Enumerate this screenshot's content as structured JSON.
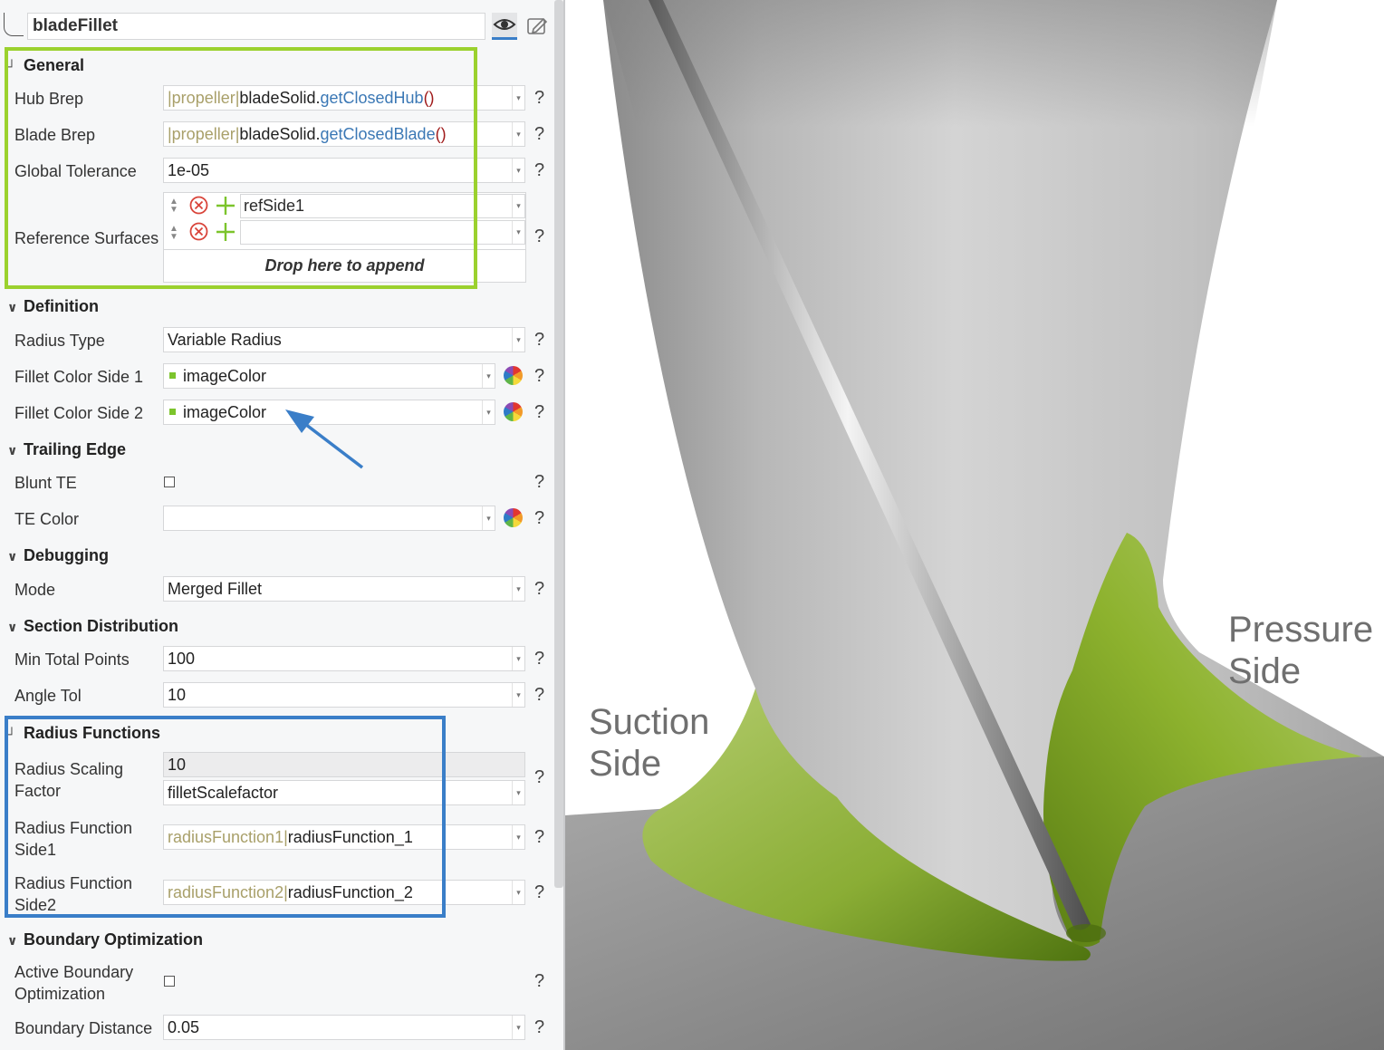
{
  "header": {
    "title": "bladeFillet",
    "eye_icon": "eye-icon",
    "edit_icon": "edit-icon"
  },
  "colors": {
    "green_box": "#9bd12e",
    "blue_box": "#3a7ec8",
    "arrow": "#3a7ec8",
    "fillet": "#8db22e"
  },
  "general": {
    "title": "General",
    "hub_brep": {
      "label": "Hub Brep",
      "ref": "|propeller|",
      "obj": "bladeSolid.",
      "fn": "getClosedHub",
      "paren": "()"
    },
    "blade_brep": {
      "label": "Blade Brep",
      "ref": "|propeller|",
      "obj": "bladeSolid.",
      "fn": "getClosedBlade",
      "paren": "()"
    },
    "global_tolerance": {
      "label": "Global Tolerance",
      "value": "1e-05"
    },
    "reference_surfaces": {
      "label": "Reference Surfaces",
      "items": [
        "refSide1",
        ""
      ],
      "drop_text": "Drop here to append"
    }
  },
  "definition": {
    "title": "Definition",
    "radius_type": {
      "label": "Radius Type",
      "value": "Variable Radius"
    },
    "fillet_color_1": {
      "label": "Fillet Color Side 1",
      "value": "imageColor"
    },
    "fillet_color_2": {
      "label": "Fillet Color Side 2",
      "value": "imageColor"
    }
  },
  "trailing_edge": {
    "title": "Trailing Edge",
    "blunt_te": {
      "label": "Blunt TE"
    },
    "te_color": {
      "label": "TE Color",
      "value": ""
    }
  },
  "debugging": {
    "title": "Debugging",
    "mode": {
      "label": "Mode",
      "value": "Merged Fillet"
    }
  },
  "section_distribution": {
    "title": "Section Distribution",
    "min_total_points": {
      "label": "Min Total Points",
      "value": "100"
    },
    "angle_tol": {
      "label": "Angle Tol",
      "value": "10"
    }
  },
  "radius_functions": {
    "title": "Radius Functions",
    "scaling": {
      "label_1": "Radius Scaling",
      "label_2": "Factor",
      "value": "10",
      "expr": "filletScalefactor"
    },
    "side1": {
      "label_1": "Radius Function",
      "label_2": "Side1",
      "ref": "radiusFunction1|",
      "value": "radiusFunction_1"
    },
    "side2": {
      "label_1": "Radius Function",
      "label_2": "Side2",
      "ref": "radiusFunction2|",
      "value": "radiusFunction_2"
    }
  },
  "boundary_optimization": {
    "title": "Boundary Optimization",
    "active": {
      "label_1": "Active Boundary",
      "label_2": "Optimization"
    },
    "distance": {
      "label": "Boundary Distance",
      "value": "0.05"
    }
  },
  "help_symbol": "?",
  "render_labels": {
    "suction_1": "Suction",
    "suction_2": "Side",
    "pressure_1": "Pressure",
    "pressure_2": "Side"
  }
}
